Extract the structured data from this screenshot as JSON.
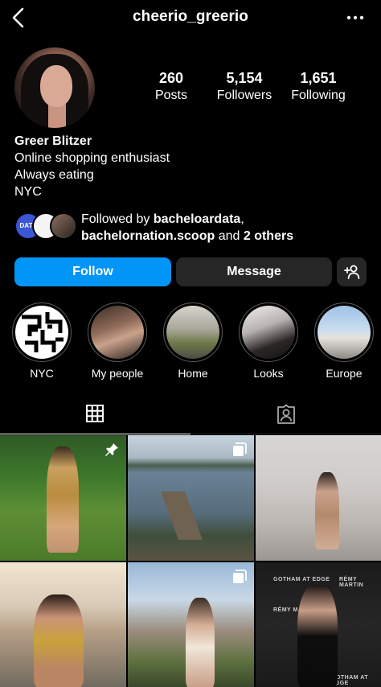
{
  "header": {
    "username": "cheerio_greerio",
    "back_icon": "chevron-left-icon",
    "more_icon": "more-horizontal-icon"
  },
  "stats": {
    "posts": {
      "value": "260",
      "label": "Posts"
    },
    "followers": {
      "value": "5,154",
      "label": "Followers"
    },
    "following": {
      "value": "1,651",
      "label": "Following"
    }
  },
  "bio": {
    "name": "Greer Blitzer",
    "lines": [
      "Online shopping enthusiast",
      "Always eating",
      "NYC"
    ]
  },
  "followed_by": {
    "prefix": "Followed by ",
    "user1": "bacheloardata",
    "separator": ",",
    "user2": "bachelornation.scoop",
    "middle": " and ",
    "others": "2 others",
    "avatar_badge_text": "DATA"
  },
  "actions": {
    "follow_label": "Follow",
    "message_label": "Message",
    "suggest_icon": "add-person-icon",
    "follow_color": "#0095f6",
    "secondary_color": "#262626"
  },
  "highlights": [
    {
      "label": "NYC"
    },
    {
      "label": "My people"
    },
    {
      "label": "Home"
    },
    {
      "label": "Looks"
    },
    {
      "label": "Europe"
    }
  ],
  "tabs": {
    "grid_icon": "grid-icon",
    "tagged_icon": "tagged-person-icon",
    "active": "grid"
  },
  "posts": {
    "pinned_icon": "pin-icon",
    "carousel_icon": "carousel-icon",
    "tile6_text": [
      "GOTHAM AT EDGE",
      "RÉMY MARTIN",
      "RÉMY MARTIN",
      "GOTHAM AT EDGE"
    ]
  }
}
